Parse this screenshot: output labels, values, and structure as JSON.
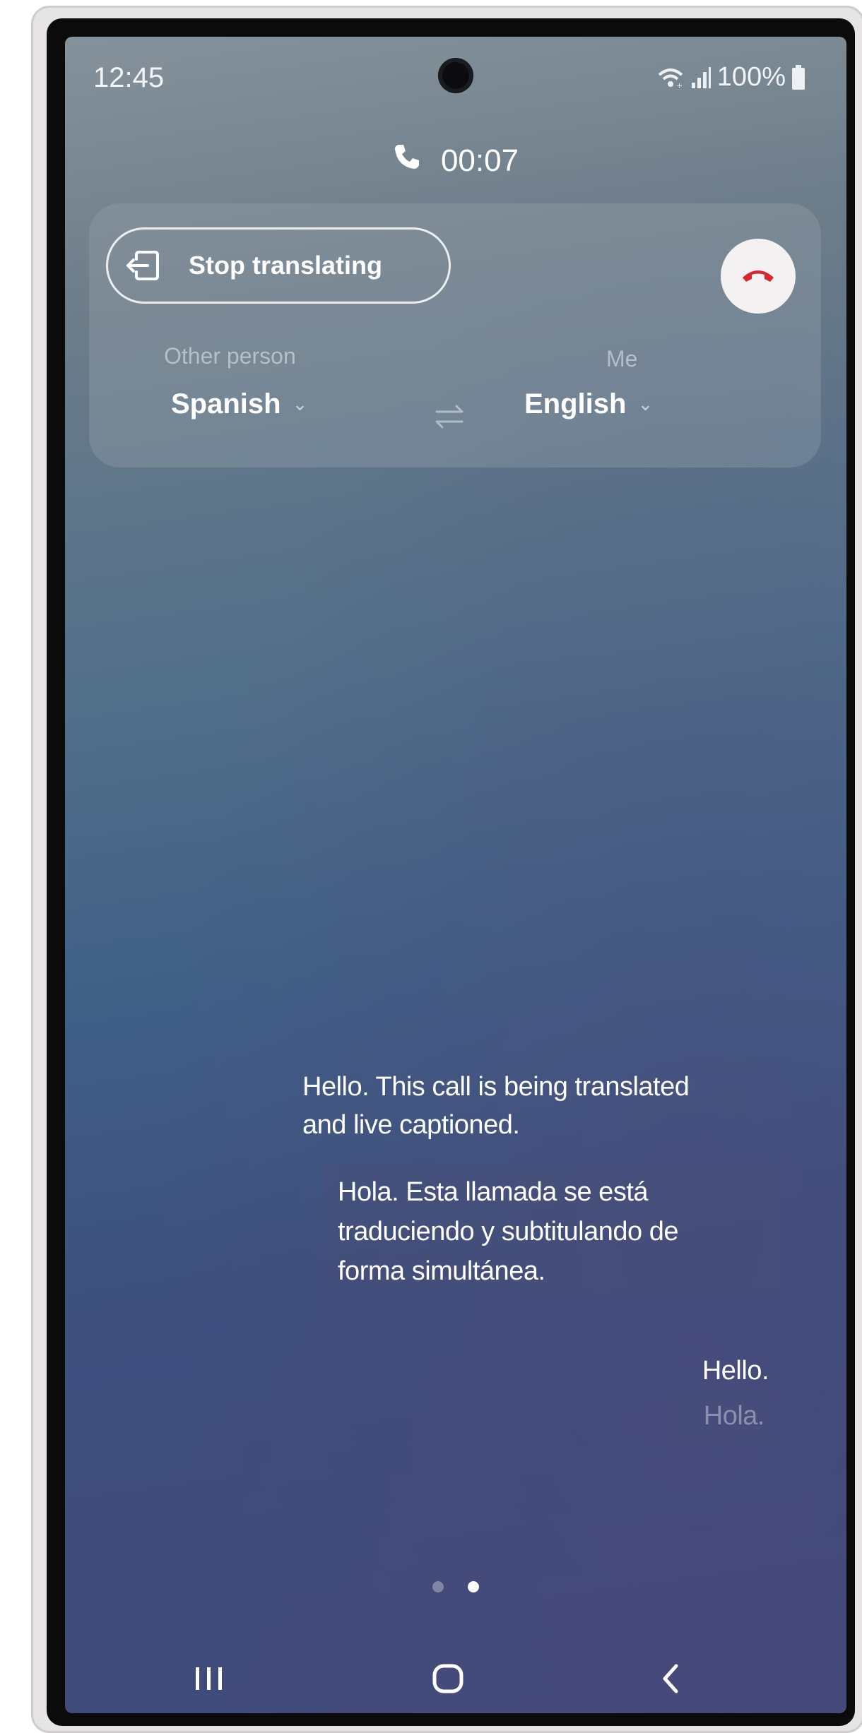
{
  "status_bar": {
    "time": "12:45",
    "battery": "100%",
    "icons": [
      "wifi-icon",
      "signal-icon",
      "battery-icon"
    ]
  },
  "call": {
    "timer": "00:07",
    "stop_label": "Stop translating",
    "end_call_color": "#d8262c"
  },
  "languages": {
    "other_label": "Other person",
    "other_value": "Spanish",
    "me_label": "Me",
    "me_value": "English"
  },
  "captions": [
    {
      "original_lines": [
        "Hello. This call is being translated",
        "and live captioned."
      ],
      "translation_lines": [
        "Hola. Esta llamada se está",
        "traduciendo y subtitulando de",
        "forma simultánea."
      ]
    },
    {
      "original_lines": [
        "Hello."
      ],
      "translation_lines": [
        "Hola."
      ]
    }
  ],
  "pager": {
    "count": 2,
    "active": 2
  },
  "nav": [
    "recents-icon",
    "home-icon",
    "back-icon"
  ]
}
